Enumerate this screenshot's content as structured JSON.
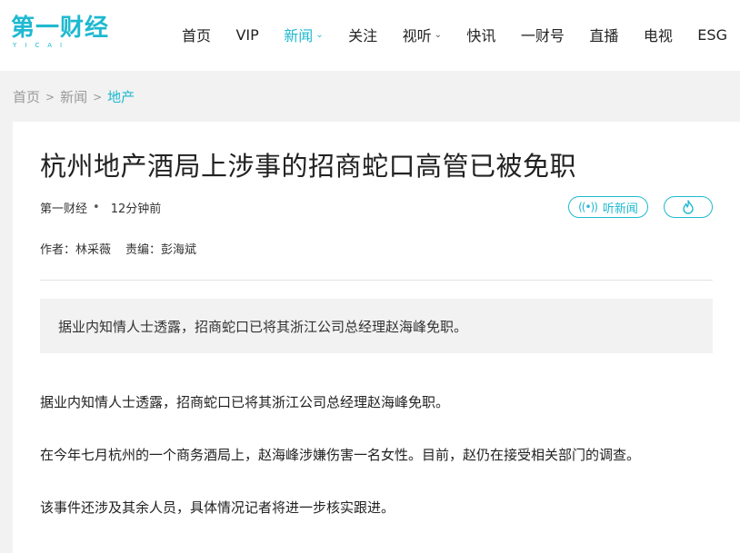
{
  "logo": {
    "text": "第一财经",
    "sub": "YICAI"
  },
  "nav": {
    "items": [
      {
        "label": "首页",
        "has_dropdown": false,
        "active": false
      },
      {
        "label": "VIP",
        "has_dropdown": false,
        "active": false
      },
      {
        "label": "新闻",
        "has_dropdown": true,
        "active": true
      },
      {
        "label": "关注",
        "has_dropdown": false,
        "active": false
      },
      {
        "label": "视听",
        "has_dropdown": true,
        "active": false
      },
      {
        "label": "快讯",
        "has_dropdown": false,
        "active": false
      },
      {
        "label": "一财号",
        "has_dropdown": false,
        "active": false
      },
      {
        "label": "直播",
        "has_dropdown": false,
        "active": false
      },
      {
        "label": "电视",
        "has_dropdown": false,
        "active": false
      },
      {
        "label": "ESG",
        "has_dropdown": false,
        "active": false
      }
    ],
    "chevron": "chevron-down-icon"
  },
  "breadcrumb": {
    "items": [
      "首页",
      "新闻",
      "地产"
    ],
    "separator": ">"
  },
  "article": {
    "title": "杭州地产酒局上涉事的招商蛇口高管已被免职",
    "source": "第一财经",
    "time": "12分钟前",
    "listen_label": "听新闻",
    "listen_icon": "audio-wave-icon",
    "hot_icon": "flame-icon",
    "author_label": "作者：",
    "author": "林采薇",
    "editor_label": "责编：",
    "editor": "彭海斌",
    "summary": "据业内知情人士透露，招商蛇口已将其浙江公司总经理赵海峰免职。",
    "paragraphs": [
      "据业内知情人士透露，招商蛇口已将其浙江公司总经理赵海峰免职。",
      "在今年七月杭州的一个商务酒局上，赵海峰涉嫌伤害一名女性。目前，赵仍在接受相关部门的调查。",
      "该事件还涉及其余人员，具体情况记者将进一步核实跟进。"
    ]
  },
  "colors": {
    "accent": "#1fb9d0",
    "page_bg": "#f2f2f2",
    "text": "#222222",
    "muted": "#999999"
  }
}
